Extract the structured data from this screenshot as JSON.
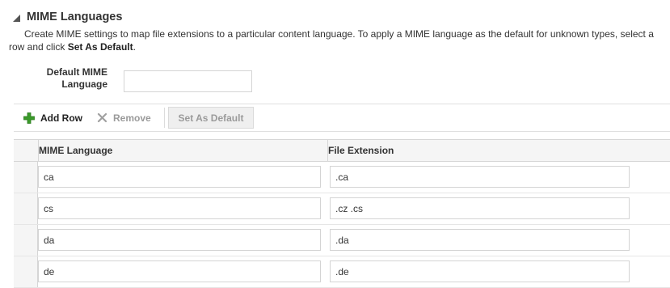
{
  "section": {
    "title": "MIME Languages",
    "description_main": "Create MIME settings to map file extensions to a particular content language. To apply a MIME language as the default for unknown types, select a row and click ",
    "description_action": "Set As Default",
    "description_end": "."
  },
  "default_field": {
    "label_line1": "Default MIME",
    "label_line2": "Language",
    "value": "",
    "placeholder": ""
  },
  "toolbar": {
    "add_label": "Add Row",
    "remove_label": "Remove",
    "set_default_label": "Set As Default",
    "add_icon": "plus-icon",
    "remove_icon": "x-icon"
  },
  "table": {
    "columns": [
      "MIME Language",
      "File Extension"
    ],
    "rows": [
      {
        "language": "ca",
        "extension": ".ca"
      },
      {
        "language": "cs",
        "extension": ".cz .cs"
      },
      {
        "language": "da",
        "extension": ".da"
      },
      {
        "language": "de",
        "extension": ".de"
      }
    ]
  },
  "colors": {
    "add_icon": "#3a9a2a",
    "disabled_text": "#9a9a9a",
    "header_bg": "#f5f5f5"
  }
}
